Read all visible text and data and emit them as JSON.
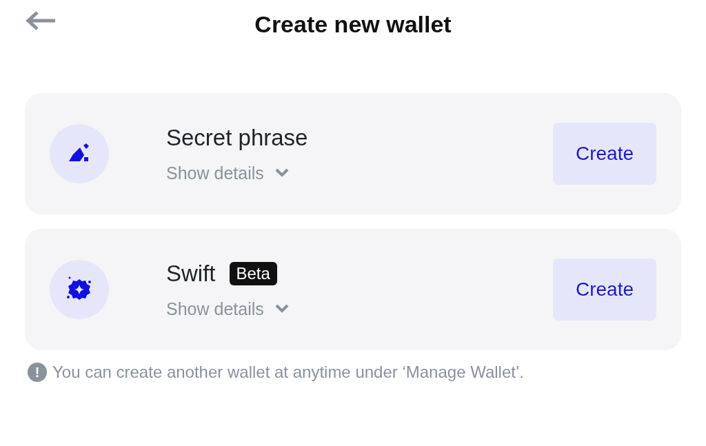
{
  "header": {
    "title": "Create new wallet"
  },
  "options": [
    {
      "kind": "pen",
      "title": "Secret phrase",
      "details": "Show details",
      "expanded": false,
      "button": "Create"
    },
    {
      "kind": "burst",
      "title": "Swift",
      "badge": "Beta",
      "details": "Show details",
      "expanded": false,
      "button": "Create"
    }
  ],
  "note": "You can create another wallet at anytime under ‘Manage Wallet’.",
  "note_icon": "!"
}
